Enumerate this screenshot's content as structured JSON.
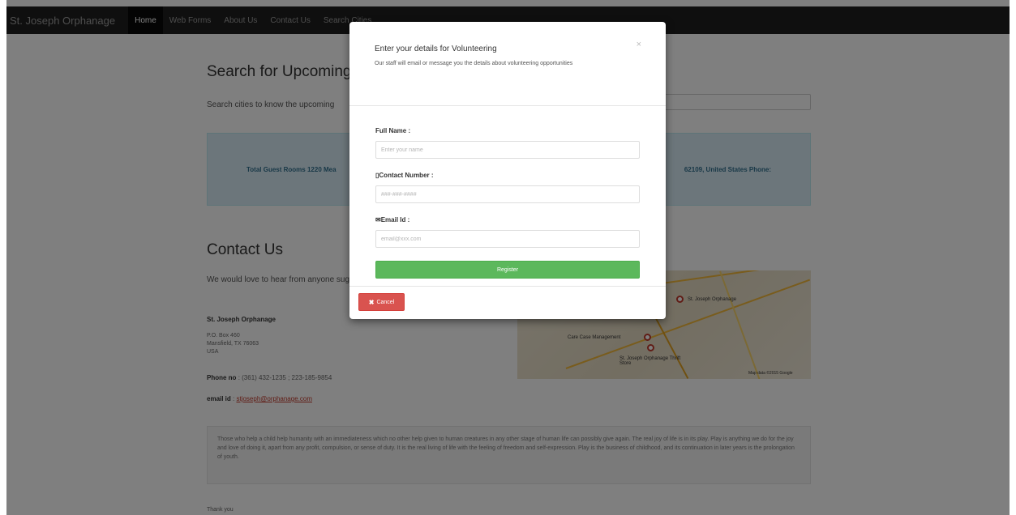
{
  "nav": {
    "brand": "St. Joseph Orphanage",
    "items": [
      "Home",
      "Web Forms",
      "About Us",
      "Contact Us",
      "Search Cities"
    ]
  },
  "search": {
    "title": "Search for Upcoming",
    "help": "Search cities to know the upcoming"
  },
  "info": {
    "left": "Total Guest Rooms 1220 Mea",
    "right": "62109, United States Phone:"
  },
  "contact": {
    "title": "Contact Us",
    "text": "We would love to hear from anyone suggestions, or with a desire to help",
    "org": "St. Joseph Orphanage",
    "address": "P.O. Box 460\nMansfield, TX 76063\nUSA",
    "phone_label": "Phone no",
    "phone_value": ": (361) 432-1235 ; 223-185-9854",
    "email_label": "email id",
    "email_value": "stjoseph@orphanage.com",
    "map_labels": [
      "St. Joseph Orphanage",
      "Care Case Management",
      "St. Joseph Orphanage Thrift Store",
      "Map data ©2015 Google"
    ]
  },
  "quote": "Those who help a child help humanity with an immediateness which no other help given to human creatures in any other stage of human life can possibly give again. The real joy of life is in its play. Play is anything we do for the joy and love of doing it, apart from any profit, compulsion, or sense of duty. It is the real living of life with the feeling of freedom and self-expression. Play is the business of childhood, and its continuation in later years is the prolongation of youth.",
  "footer_text": "Thank you",
  "modal": {
    "title": "Enter your details for Volunteering",
    "subtitle": "Our staff will email or message you the details about volunteering opportunities",
    "close": "×",
    "fields": [
      {
        "label": "Full Name :",
        "placeholder": "Enter your name"
      },
      {
        "label": "Contact Number :",
        "placeholder": "###-###-####"
      },
      {
        "label": "Email Id :",
        "placeholder": "email@xxx.com"
      }
    ],
    "register": "Register",
    "cancel": "Cancel"
  },
  "colors": {
    "navbar": "#1f1f1f",
    "register": "#5cb85c",
    "cancel": "#d9534f",
    "info_well": "#d9edf7"
  }
}
